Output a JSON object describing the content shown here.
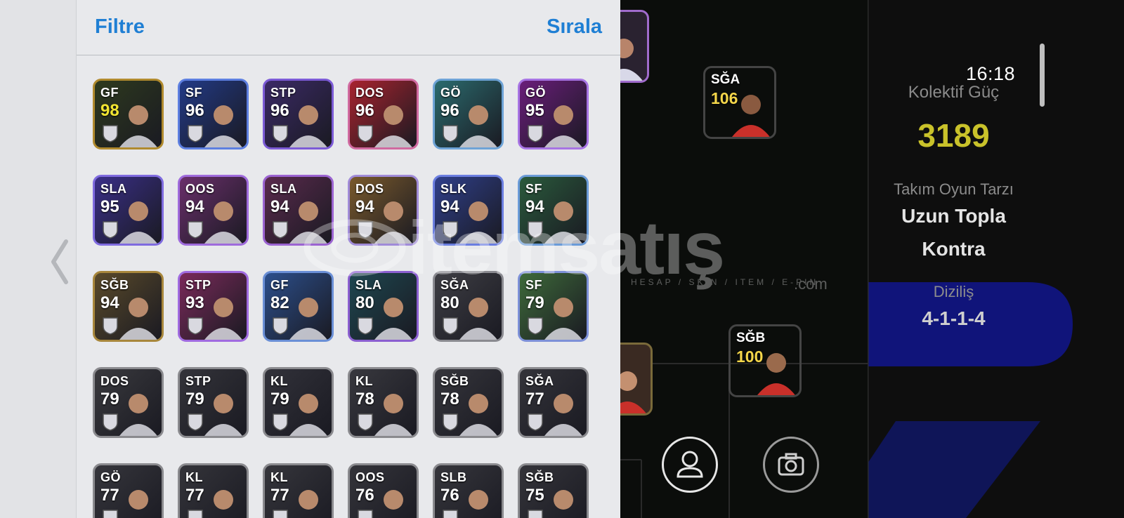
{
  "panel": {
    "filter_label": "Filtre",
    "sort_label": "Sırala"
  },
  "cards": [
    {
      "pos": "GF",
      "rating": "98",
      "rating_color": "#f1e532",
      "bg": "#2e3a1e",
      "border": "#b08a2e"
    },
    {
      "pos": "SF",
      "rating": "96",
      "rating_color": "#ffffff",
      "bg": "#223a86",
      "border": "#5d7fe0"
    },
    {
      "pos": "STP",
      "rating": "96",
      "rating_color": "#ffffff",
      "bg": "#3b2a66",
      "border": "#7c5bd6"
    },
    {
      "pos": "DOS",
      "rating": "96",
      "rating_color": "#ffffff",
      "bg": "#a8232e",
      "border": "#d06aa0"
    },
    {
      "pos": "GÖ",
      "rating": "96",
      "rating_color": "#ffffff",
      "bg": "#2b6b6e",
      "border": "#6ea3d6"
    },
    {
      "pos": "GÖ",
      "rating": "95",
      "rating_color": "#ffffff",
      "bg": "#6a1d7a",
      "border": "#a774e3"
    },
    {
      "pos": "SLA",
      "rating": "95",
      "rating_color": "#ffffff",
      "bg": "#3a2f88",
      "border": "#7f6bdf"
    },
    {
      "pos": "OOS",
      "rating": "94",
      "rating_color": "#ffffff",
      "bg": "#6a2f6b",
      "border": "#9f6bdc"
    },
    {
      "pos": "SLA",
      "rating": "94",
      "rating_color": "#ffffff",
      "bg": "#5a2a4d",
      "border": "#9b63d1"
    },
    {
      "pos": "DOS",
      "rating": "94",
      "rating_color": "#ffffff",
      "bg": "#7a5a2c",
      "border": "#a08bd8"
    },
    {
      "pos": "SLK",
      "rating": "94",
      "rating_color": "#ffffff",
      "bg": "#2f3f8a",
      "border": "#6b7ee0"
    },
    {
      "pos": "SF",
      "rating": "94",
      "rating_color": "#ffffff",
      "bg": "#2a5a3c",
      "border": "#6b9bd8"
    },
    {
      "pos": "SĞB",
      "rating": "94",
      "rating_color": "#ffffff",
      "bg": "#5a4a2a",
      "border": "#a8873c"
    },
    {
      "pos": "STP",
      "rating": "93",
      "rating_color": "#ffffff",
      "bg": "#7a2a5a",
      "border": "#a06be0"
    },
    {
      "pos": "GF",
      "rating": "82",
      "rating_color": "#ffffff",
      "bg": "#2c4f8c",
      "border": "#6a8fd6"
    },
    {
      "pos": "SLA",
      "rating": "80",
      "rating_color": "#ffffff",
      "bg": "#1e4750",
      "border": "#8b5fd0"
    },
    {
      "pos": "SĞA",
      "rating": "80",
      "rating_color": "#ffffff",
      "bg": "#3e3e44",
      "border": "#8a8a90"
    },
    {
      "pos": "SF",
      "rating": "79",
      "rating_color": "#ffffff",
      "bg": "#3e6a3a",
      "border": "#7d90d8"
    },
    {
      "pos": "DOS",
      "rating": "79",
      "rating_color": "#ffffff",
      "bg": "#3a3a3e",
      "border": "#8a8a8e"
    },
    {
      "pos": "STP",
      "rating": "79",
      "rating_color": "#ffffff",
      "bg": "#34343a",
      "border": "#8a8a8e"
    },
    {
      "pos": "KL",
      "rating": "79",
      "rating_color": "#ffffff",
      "bg": "#32323a",
      "border": "#8a8a8e"
    },
    {
      "pos": "KL",
      "rating": "78",
      "rating_color": "#ffffff",
      "bg": "#38383e",
      "border": "#8a8a8e"
    },
    {
      "pos": "SĞB",
      "rating": "78",
      "rating_color": "#ffffff",
      "bg": "#36363c",
      "border": "#8a8a8e"
    },
    {
      "pos": "SĞA",
      "rating": "77",
      "rating_color": "#ffffff",
      "bg": "#34343a",
      "border": "#8a8a8e"
    },
    {
      "pos": "GÖ",
      "rating": "77",
      "rating_color": "#ffffff",
      "bg": "#36363c",
      "border": "#8a8a8e"
    },
    {
      "pos": "KL",
      "rating": "77",
      "rating_color": "#ffffff",
      "bg": "#34343a",
      "border": "#8a8a8e"
    },
    {
      "pos": "KL",
      "rating": "77",
      "rating_color": "#ffffff",
      "bg": "#36363c",
      "border": "#8a8a8e"
    },
    {
      "pos": "OOS",
      "rating": "76",
      "rating_color": "#ffffff",
      "bg": "#34343a",
      "border": "#8a8a8e"
    },
    {
      "pos": "SLB",
      "rating": "76",
      "rating_color": "#ffffff",
      "bg": "#36363c",
      "border": "#8a8a8e"
    },
    {
      "pos": "SĞB",
      "rating": "75",
      "rating_color": "#ffffff",
      "bg": "#34343a",
      "border": "#8a8a8e"
    }
  ],
  "pitch_cards": [
    {
      "pos": "SĞA",
      "rating": "106",
      "border": "#b0863a",
      "bg": "#5a3a1a"
    },
    {
      "pos": "SĞB",
      "rating": "100",
      "border": "#3fbf3f",
      "bg": "#2a4a2a"
    }
  ],
  "info": {
    "time": "16:18",
    "power_label": "Kolektif Güç",
    "power_value": "3189",
    "style_label": "Takım Oyun Tarzı",
    "style_line1": "Uzun Topla",
    "style_line2": "Kontra",
    "formation_label": "Diziliş",
    "formation_value": "4-1-1-4"
  },
  "watermark": {
    "main": "itemsatış",
    "sub": "HESAP / SKIN / ITEM / E-PIN",
    "suffix": ".com"
  },
  "colors": {
    "accent_blue": "#1f7fd4",
    "power_yellow": "#c9c22a"
  }
}
